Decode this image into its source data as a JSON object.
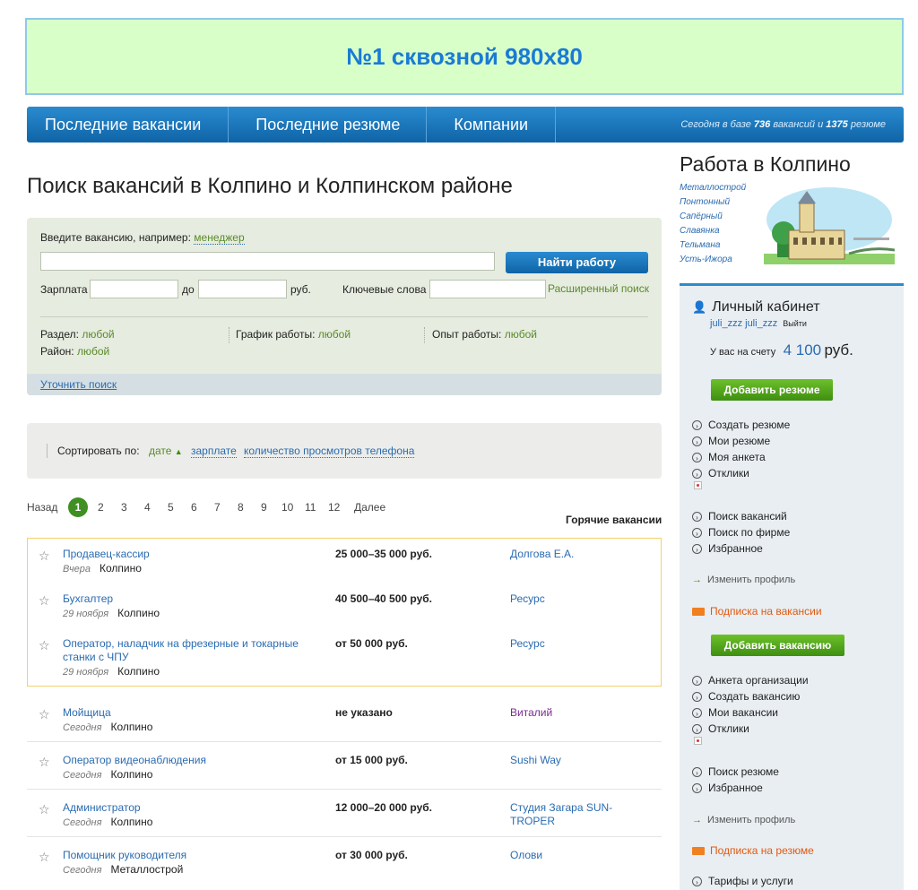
{
  "banner": {
    "text": "№1 сквозной 980x80"
  },
  "nav": {
    "tabs": [
      "Последние вакансии",
      "Последние резюме",
      "Компании"
    ],
    "stat_prefix": "Сегодня в базе",
    "vacancies_count": "736",
    "stat_mid": "вакансий и",
    "resumes_count": "1375",
    "stat_suffix": "резюме"
  },
  "page_title": "Поиск вакансий в Колпино и Колпинском районе",
  "search": {
    "prompt": "Введите вакансию, например:",
    "example": "менеджер",
    "find_button": "Найти работу",
    "salary_label": "Зарплата",
    "to_label": "до",
    "currency": "руб.",
    "keywords_label": "Ключевые слова",
    "advanced": "Расширенный поиск",
    "section_label": "Раздел:",
    "section_value": "любой",
    "schedule_label": "График работы:",
    "schedule_value": "любой",
    "experience_label": "Опыт работы:",
    "experience_value": "любой",
    "district_label": "Район:",
    "district_value": "любой",
    "refine": "Уточнить поиск"
  },
  "sort": {
    "label": "Сортировать по:",
    "options": [
      "дате",
      "зарплате",
      "количество просмотров телефона"
    ],
    "arrow": "▲"
  },
  "pagination": {
    "prev": "Назад",
    "pages": [
      "1",
      "2",
      "3",
      "4",
      "5",
      "6",
      "7",
      "8",
      "9",
      "10",
      "11",
      "12"
    ],
    "next": "Далее"
  },
  "hot_label": "Горячие вакансии",
  "jobs": [
    {
      "title": "Продавец-кассир",
      "date": "Вчера",
      "place": "Колпино",
      "salary": "25 000–35 000 руб.",
      "company": "Долгова Е.А."
    },
    {
      "title": "Бухгалтер",
      "date": "29 ноября",
      "place": "Колпино",
      "salary": "40 500–40 500 руб.",
      "company": "Ресурс"
    },
    {
      "title": "Оператор, наладчик на фрезерные и токарные станки с ЧПУ",
      "date": "29 ноября",
      "place": "Колпино",
      "salary": "от 50 000 руб.",
      "company": "Ресурс"
    },
    {
      "title": "Мойщица",
      "date": "Сегодня",
      "place": "Колпино",
      "salary": "не указано",
      "company": "Виталий"
    },
    {
      "title": "Оператор видеонаблюдения",
      "date": "Сегодня",
      "place": "Колпино",
      "salary": "от 15 000 руб.",
      "company": "Sushi Way"
    },
    {
      "title": "Администратор",
      "date": "Сегодня",
      "place": "Колпино",
      "salary": "12 000–20 000 руб.",
      "company": "Студия Загара SUN-TROPER"
    },
    {
      "title": "Помощник руководителя",
      "date": "Сегодня",
      "place": "Металлострой",
      "salary": "от 30 000 руб.",
      "company": "Олови"
    }
  ],
  "sidebar": {
    "title": "Работа в Колпино",
    "towns": [
      "Металлострой",
      "Понтонный",
      "Сапёрный",
      "Славянка",
      "Тельмана",
      "Усть-Ижора"
    ],
    "cabinet_title": "Личный кабинет",
    "user": "juli_zzz juli_zzz",
    "logout": "Выйти",
    "balance_label": "У вас на счету",
    "balance_value": "4 100",
    "balance_currency": "руб.",
    "add_resume": "Добавить резюме",
    "resume_menu": [
      "Создать резюме",
      "Мои резюме",
      "Моя анкета",
      "Отклики"
    ],
    "search_menu": [
      "Поиск вакансий",
      "Поиск по фирме",
      "Избранное"
    ],
    "edit_profile": "Изменить профиль",
    "subscribe_vac": "Подписка на вакансии",
    "add_vacancy": "Добавить вакансию",
    "org_menu": [
      "Анкета организации",
      "Создать вакансию",
      "Мои вакансии",
      "Отклики"
    ],
    "search_menu2": [
      "Поиск резюме",
      "Избранное"
    ],
    "edit_profile2": "Изменить профиль",
    "subscribe_res": "Подписка на резюме",
    "tariffs": "Тарифы и услуги"
  },
  "colors": {
    "accent": "#1a7bd6",
    "green": "#3f8f12",
    "banner_bg": "#d9ffc8"
  }
}
